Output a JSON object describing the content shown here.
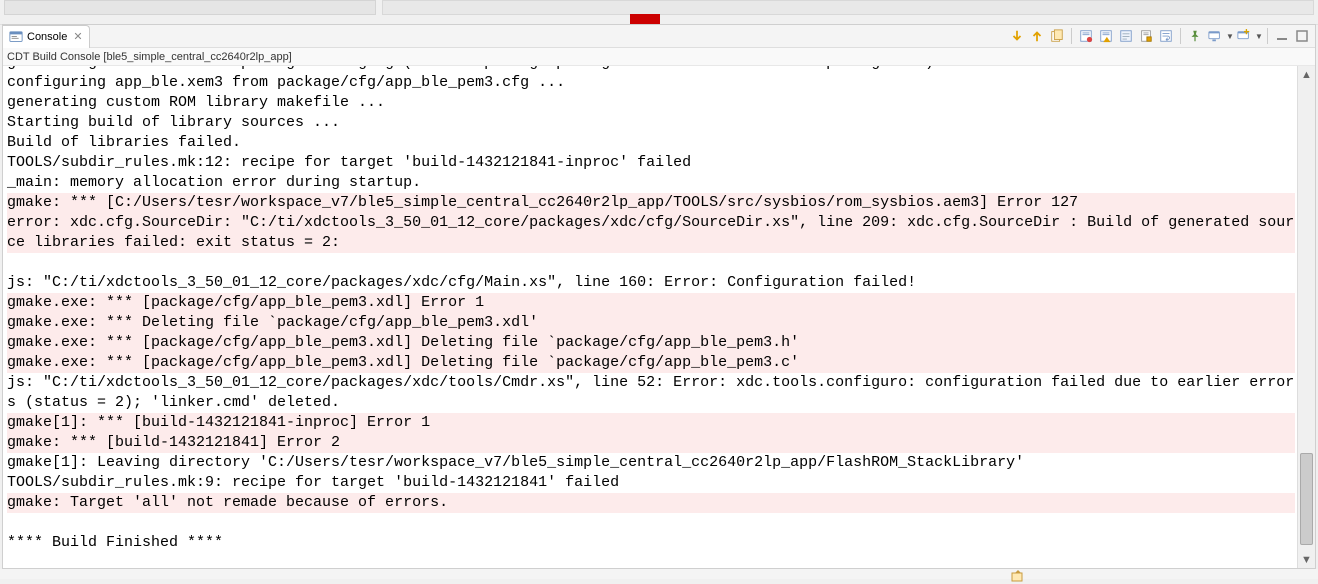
{
  "tab": {
    "title": "Console"
  },
  "subheader": "CDT Build Console [ble5_simple_central_cc2640r2lp_app]",
  "toolbar": {
    "next_icon": "arrow-down",
    "prev_icon": "arrow-up",
    "pin_icon": "pin",
    "display_icon": "display-selected",
    "display2_icon": "display",
    "clear_icon": "clear",
    "scroll_lock_icon": "scroll-lock",
    "word_wrap_icon": "word-wrap",
    "open_icon": "open-console",
    "new_icon": "new-console",
    "min_icon": "minimize",
    "max_icon": "maximize"
  },
  "console_lines": [
    {
      "t": "generating interfaces for package configPkg (because package/package.xdc.inc is older than package.xdc) ...",
      "err": false
    },
    {
      "t": "configuring app_ble.xem3 from package/cfg/app_ble_pem3.cfg ...",
      "err": false
    },
    {
      "t": "generating custom ROM library makefile ...",
      "err": false
    },
    {
      "t": "Starting build of library sources ...",
      "err": false
    },
    {
      "t": "Build of libraries failed.",
      "err": false
    },
    {
      "t": "TOOLS/subdir_rules.mk:12: recipe for target 'build-1432121841-inproc' failed",
      "err": false
    },
    {
      "t": "_main: memory allocation error during startup.",
      "err": false
    },
    {
      "t": "gmake: *** [C:/Users/tesr/workspace_v7/ble5_simple_central_cc2640r2lp_app/TOOLS/src/sysbios/rom_sysbios.aem3] Error 127",
      "err": true
    },
    {
      "t": "error: xdc.cfg.SourceDir: \"C:/ti/xdctools_3_50_01_12_core/packages/xdc/cfg/SourceDir.xs\", line 209: xdc.cfg.SourceDir : Build of generated source libraries failed: exit status = 2:",
      "err": true
    },
    {
      "t": "",
      "err": false
    },
    {
      "t": "js: \"C:/ti/xdctools_3_50_01_12_core/packages/xdc/cfg/Main.xs\", line 160: Error: Configuration failed!",
      "err": false
    },
    {
      "t": "gmake.exe: *** [package/cfg/app_ble_pem3.xdl] Error 1",
      "err": true
    },
    {
      "t": "gmake.exe: *** Deleting file `package/cfg/app_ble_pem3.xdl'",
      "err": true
    },
    {
      "t": "gmake.exe: *** [package/cfg/app_ble_pem3.xdl] Deleting file `package/cfg/app_ble_pem3.h'",
      "err": true
    },
    {
      "t": "gmake.exe: *** [package/cfg/app_ble_pem3.xdl] Deleting file `package/cfg/app_ble_pem3.c'",
      "err": true
    },
    {
      "t": "js: \"C:/ti/xdctools_3_50_01_12_core/packages/xdc/tools/Cmdr.xs\", line 52: Error: xdc.tools.configuro: configuration failed due to earlier errors (status = 2); 'linker.cmd' deleted.",
      "err": false
    },
    {
      "t": "gmake[1]: *** [build-1432121841-inproc] Error 1",
      "err": true
    },
    {
      "t": "gmake: *** [build-1432121841] Error 2",
      "err": true
    },
    {
      "t": "gmake[1]: Leaving directory 'C:/Users/tesr/workspace_v7/ble5_simple_central_cc2640r2lp_app/FlashROM_StackLibrary'",
      "err": false
    },
    {
      "t": "TOOLS/subdir_rules.mk:9: recipe for target 'build-1432121841' failed",
      "err": false
    },
    {
      "t": "gmake: Target 'all' not remade because of errors.",
      "err": true
    },
    {
      "t": "",
      "err": false
    },
    {
      "t": "**** Build Finished ****",
      "err": false
    }
  ]
}
